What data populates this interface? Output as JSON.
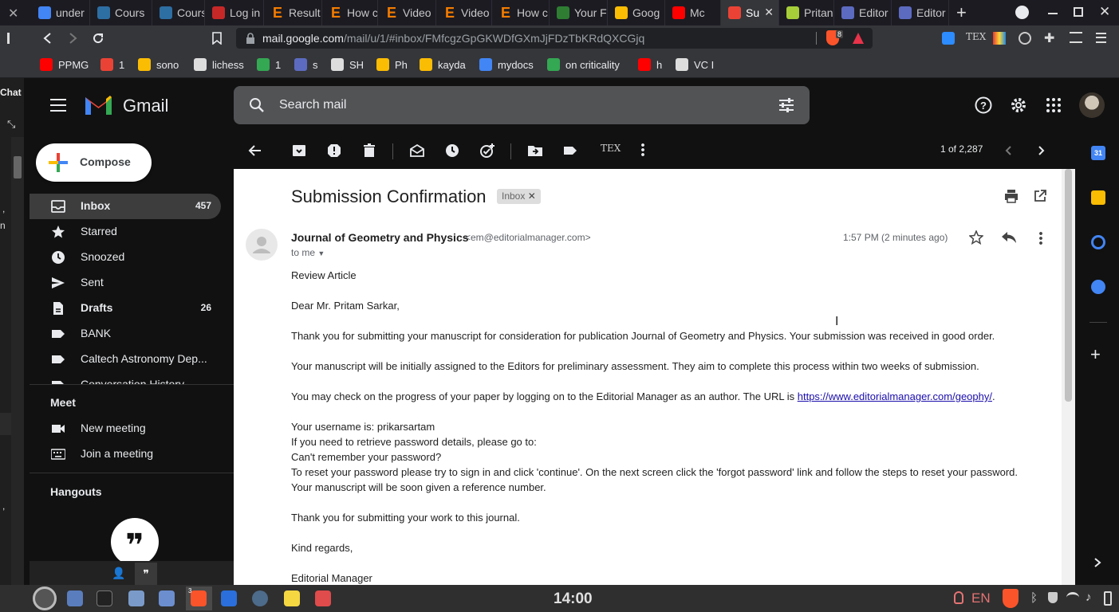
{
  "browser": {
    "tabs": [
      {
        "label": "under",
        "color": "#4285f4",
        "icon": "google-g"
      },
      {
        "label": "Cours",
        "color": "#2d6ea3",
        "icon": "globe"
      },
      {
        "label": "Cours",
        "color": "#2d6ea3",
        "icon": "globe"
      },
      {
        "label": "Log in",
        "color": "#c62828",
        "icon": "circle"
      },
      {
        "label": "Result",
        "color": "#f57c00",
        "icon": "E"
      },
      {
        "label": "How c",
        "color": "#f57c00",
        "icon": "E"
      },
      {
        "label": "Video",
        "color": "#f57c00",
        "icon": "E"
      },
      {
        "label": "Video",
        "color": "#f57c00",
        "icon": "E"
      },
      {
        "label": "How c",
        "color": "#f57c00",
        "icon": "E"
      },
      {
        "label": "Your F",
        "color": "#2e7d32",
        "icon": "leaf"
      },
      {
        "label": "Goog",
        "color": "#fbbc04",
        "icon": "keep"
      },
      {
        "label": "Mc",
        "color": "#ff0000",
        "icon": "youtube"
      },
      {
        "label": "Su",
        "color": "#ea4335",
        "icon": "gmail"
      },
      {
        "label": "Pritan",
        "color": "#a6ce39",
        "icon": "orcid"
      },
      {
        "label": "Editor",
        "color": "#5c6bc0",
        "icon": "doc"
      },
      {
        "label": "Editor",
        "color": "#5c6bc0",
        "icon": "doc"
      }
    ],
    "url_host": "mail.google.com",
    "url_path": "/mail/u/1/#inbox/FMfcgzGpGKWDfGXmJjFDzTbKRdQXCGjq",
    "brave_badge": "8",
    "bookmarks": [
      {
        "label": "PPMG",
        "color": "#ff0000",
        "icon": "youtube"
      },
      {
        "label": "1",
        "color": "#ea4335",
        "icon": "gmail"
      },
      {
        "label": "sono",
        "color": "#fbbc04",
        "icon": "keep"
      },
      {
        "label": "lichess",
        "color": "#ffffff",
        "icon": "knight"
      },
      {
        "label": "1",
        "color": "#34a853",
        "icon": "classroom"
      },
      {
        "label": "s",
        "color": "#5c6bc0",
        "icon": "gem"
      },
      {
        "label": "SH",
        "color": "#ffffff",
        "icon": "globe"
      },
      {
        "label": "Ph",
        "color": "#fbbc04",
        "icon": "photos"
      },
      {
        "label": "kayda",
        "color": "#fbbc04",
        "icon": "slides"
      },
      {
        "label": "mydocs",
        "color": "#4285f4",
        "icon": "docs"
      },
      {
        "label": "on criticality",
        "color": "#34a853",
        "icon": "drive"
      },
      {
        "label": "h",
        "color": "#ff0000",
        "icon": "youtube"
      },
      {
        "label": "VC I",
        "color": "#ffffff",
        "icon": "wikipedia"
      }
    ]
  },
  "chat_strip": {
    "title": "Chat"
  },
  "gmail": {
    "brand": "Gmail",
    "search_placeholder": "Search mail",
    "compose_label": "Compose",
    "nav": [
      {
        "label": "Inbox",
        "count": "457",
        "icon": "inbox-icon",
        "active": true,
        "bold": true
      },
      {
        "label": "Starred",
        "count": "",
        "icon": "star-icon",
        "active": false,
        "bold": false
      },
      {
        "label": "Snoozed",
        "count": "",
        "icon": "clock-icon",
        "active": false,
        "bold": false
      },
      {
        "label": "Sent",
        "count": "",
        "icon": "send-icon",
        "active": false,
        "bold": false
      },
      {
        "label": "Drafts",
        "count": "26",
        "icon": "draft-icon",
        "active": false,
        "bold": true
      },
      {
        "label": "BANK",
        "count": "",
        "icon": "label-icon",
        "active": false,
        "bold": false
      },
      {
        "label": "Caltech Astronomy Dep...",
        "count": "",
        "icon": "label-icon",
        "active": false,
        "bold": false
      },
      {
        "label": "Conversation History",
        "count": "",
        "icon": "label-icon",
        "active": false,
        "bold": false
      }
    ],
    "meet": {
      "title": "Meet",
      "new_meeting": "New meeting",
      "join_meeting": "Join a meeting"
    },
    "hangouts_title": "Hangouts",
    "pagination": "1 of 2,287",
    "message": {
      "subject": "Submission Confirmation",
      "tag": "Inbox",
      "sender_name": "Journal of Geometry and Physics",
      "sender_email": "<em@editorialmanager.com>",
      "to": "to me",
      "time": "1:57 PM (2 minutes ago)",
      "lines": [
        "Review Article",
        "Dear Mr. Pritam Sarkar,",
        "Thank you for submitting your manuscript for consideration for publication Journal of Geometry and Physics. Your submission was received in good order.",
        "Your manuscript will be initially assigned to the Editors for preliminary assessment.  They aim to complete this process within two weeks of submission.",
        "You may check on the progress of your paper by logging on to the Editorial Manager as an author. The URL is ",
        "Your username is: prikarsartam",
        "If you need to retrieve password details, please go to:",
        "Can't remember your password?",
        "To reset your password please try to sign in and click 'continue'. On the next screen click the 'forgot password' link and follow the steps to reset your password.",
        "Your manuscript will be soon given a reference number.",
        "Thank you for submitting your work to this journal.",
        "Kind regards,",
        "Editorial Manager"
      ],
      "url_link": "https://www.editorialmanager.com/geophy/",
      "url_suffix": "."
    }
  },
  "taskbar": {
    "clock": "14:00",
    "lang": "EN",
    "badge": "3"
  }
}
